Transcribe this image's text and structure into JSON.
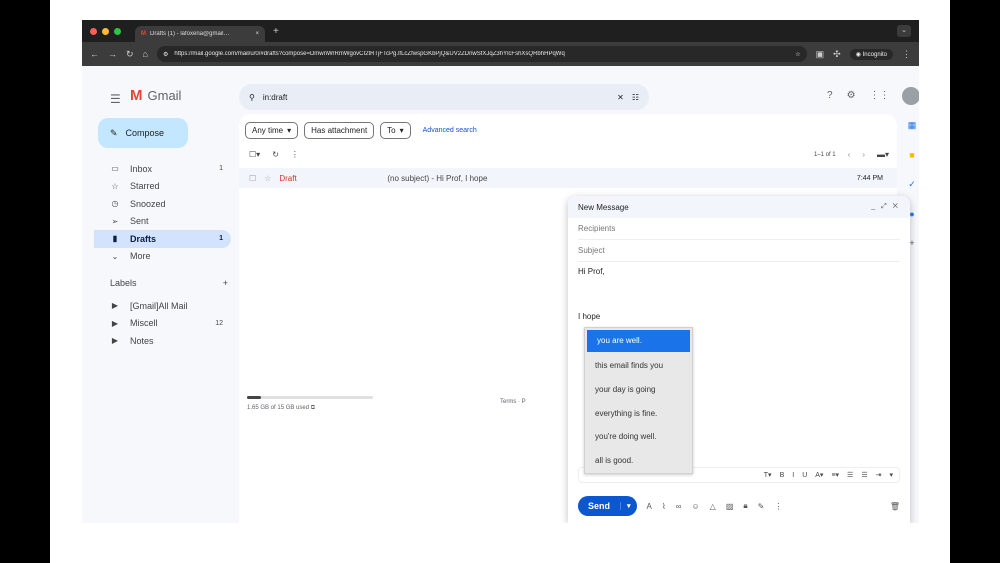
{
  "browser": {
    "tab_title": "Drafts (1) - lafoxena@gmail…",
    "url": "https://mail.google.com/mail/u/0/#drafts?compose=DmwnWrRmWgovCI2tRTjFTcPg.lfLcZfwspGKbPjQ&UV2ZDnwSfXJqZ3hYlcFshXsQRbhHPqWq",
    "incognito_label": "Incognito",
    "tab_close": "×",
    "new_tab": "+",
    "traffic_colors": [
      "#ff5f57",
      "#febc2e",
      "#28c840"
    ]
  },
  "gmail": {
    "app_name": "Gmail",
    "logo_letter": "M",
    "search_query": "in:draft"
  },
  "sidebar": {
    "compose_label": "Compose",
    "items": [
      {
        "icon": "inbox-icon",
        "glyph": "▭",
        "label": "Inbox",
        "count": "1"
      },
      {
        "icon": "star-icon",
        "glyph": "☆",
        "label": "Starred",
        "count": ""
      },
      {
        "icon": "clock-icon",
        "glyph": "◷",
        "label": "Snoozed",
        "count": ""
      },
      {
        "icon": "send-icon",
        "glyph": "➢",
        "label": "Sent",
        "count": ""
      },
      {
        "icon": "draft-icon",
        "glyph": "▮",
        "label": "Drafts",
        "count": "1"
      },
      {
        "icon": "chevron-down-icon",
        "glyph": "⌄",
        "label": "More",
        "count": ""
      }
    ],
    "labels_title": "Labels",
    "labels_add": "+",
    "labels": [
      {
        "label": "[Gmail]All Mail",
        "count": ""
      },
      {
        "label": "Miscell",
        "count": "12"
      },
      {
        "label": "Notes",
        "count": ""
      }
    ]
  },
  "filters": {
    "any_time": "Any time",
    "has_attachment": "Has attachment",
    "to": "To",
    "advanced": "Advanced search"
  },
  "list": {
    "pagination": "1–1 of 1",
    "rows": [
      {
        "tag": "Draft",
        "subject": "(no subject) - Hi Prof, I hope",
        "time": "7:44 PM"
      }
    ]
  },
  "storage": {
    "text": "1.65 GB of 15 GB used",
    "fraction": 0.11
  },
  "footer": {
    "terms": "Terms · P"
  },
  "compose": {
    "title": "New Message",
    "recipients_placeholder": "Recipients",
    "subject_placeholder": "Subject",
    "body_line1": "Hi Prof,",
    "body_line2": "I hope",
    "send_label": "Send",
    "suggestions": [
      "you are well.",
      "this email finds you",
      "your day is going",
      "everything is fine.",
      "you're doing well.",
      "all is good."
    ]
  }
}
